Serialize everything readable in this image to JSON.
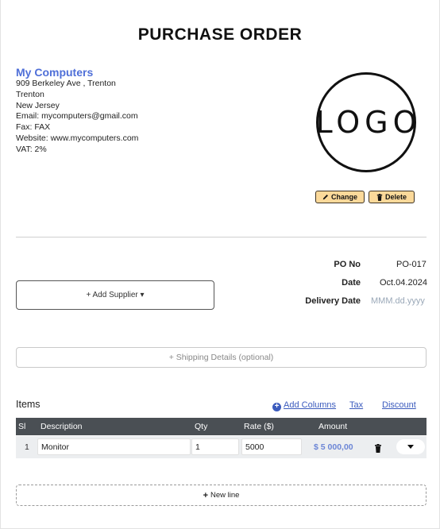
{
  "title": "PURCHASE ORDER",
  "company": {
    "name": "My Computers",
    "address_line": "909 Berkeley Ave , Trenton",
    "city": "Trenton",
    "state": "New Jersey",
    "email": "Email: mycomputers@gmail.com",
    "fax": "Fax: FAX",
    "website": "Website: www.mycomputers.com",
    "vat": "VAT: 2%"
  },
  "logo": {
    "text": "LOGO",
    "change_label": "Change",
    "delete_label": "Delete"
  },
  "meta": {
    "po_no_label": "PO No",
    "po_no_value": "PO-017",
    "date_label": "Date",
    "date_value": "Oct.04.2024",
    "delivery_label": "Delivery Date",
    "delivery_placeholder": "MMM.dd.yyyy"
  },
  "supplier": {
    "add_label": "+ Add Supplier ▾"
  },
  "shipping": {
    "label": "+ Shipping Details (optional)"
  },
  "items": {
    "title": "Items",
    "add_columns": "Add Columns",
    "tax": "Tax",
    "discount": "Discount",
    "columns": {
      "sl": "Sl",
      "description": "Description",
      "qty": "Qty",
      "rate": "Rate ($)",
      "amount": "Amount"
    },
    "rows": [
      {
        "sl": "1",
        "description": "Monitor",
        "qty": "1",
        "rate": "5000",
        "amount": "$ 5 000,00"
      }
    ],
    "new_line": "New line"
  },
  "colors": {
    "accent": "#4f6fd8",
    "link": "#3b5bbd",
    "button_bg": "#fbd99a",
    "table_header": "#4a4f54"
  }
}
